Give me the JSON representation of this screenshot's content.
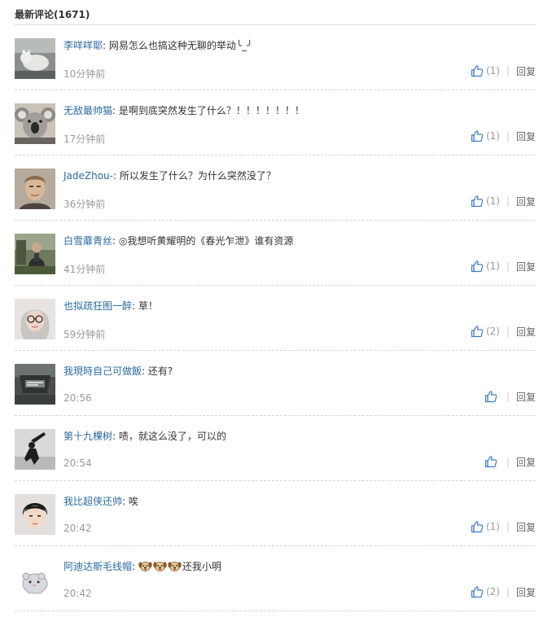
{
  "header": {
    "title": "最新评论(1671)"
  },
  "comments": [
    {
      "username": "李咩咩耶",
      "colon": ":",
      "text": "网易怎么也搞这种无聊的举动╰_╯",
      "time": "10分钟前",
      "likes": "(1)",
      "reply_label": "回复",
      "avatar_icon": "cat-photo-avatar"
    },
    {
      "username": "无敌最帅猫",
      "colon": ":",
      "text": "是啊到底突然发生了什么？！！！！！！！",
      "time": "17分钟前",
      "likes": "(1)",
      "reply_label": "回复",
      "avatar_icon": "koala-photo-avatar"
    },
    {
      "username": "JadeZhou-",
      "colon": ":",
      "text": "所以发生了什么？为什么突然没了？",
      "time": "36分钟前",
      "likes": "(1)",
      "reply_label": "回复",
      "avatar_icon": "portrait-photo-avatar"
    },
    {
      "username": "白雪蘼青丝",
      "colon": ":",
      "text": "◎我想听黄耀明的《春光乍泄》谁有资源",
      "time": "41分钟前",
      "likes": "(1)",
      "reply_label": "回复",
      "avatar_icon": "outdoor-photo-avatar"
    },
    {
      "username": "也拟疏狂图一醉",
      "colon": ":",
      "text": "草！",
      "time": "59分钟前",
      "likes": "(2)",
      "reply_label": "回复",
      "avatar_icon": "glasses-portrait-avatar"
    },
    {
      "username": "我現時自己可做飯",
      "colon": ":",
      "text": "还有?",
      "time": "20:56",
      "likes": "",
      "reply_label": "回复",
      "avatar_icon": "billboard-photo-avatar"
    },
    {
      "username": "第十九棵树",
      "colon": ":",
      "text": "啧，就这么没了，可以的",
      "time": "20:54",
      "likes": "",
      "reply_label": "回复",
      "avatar_icon": "silhouette-photo-avatar"
    },
    {
      "username": "我比超侠还帅",
      "colon": ":",
      "text": "唉",
      "time": "20:42",
      "likes": "(1)",
      "reply_label": "回复",
      "avatar_icon": "short-hair-portrait-avatar"
    },
    {
      "username": "阿迪达斯毛线帽",
      "colon": ":",
      "text": "还我小明",
      "time": "20:42",
      "likes": "(2)",
      "reply_label": "回复",
      "avatar_icon": "hamster-avatar",
      "emoji_count": 3
    }
  ],
  "colors": {
    "username": "#2a6aa0",
    "like_icon": "#3d7cc9",
    "time": "#999999",
    "divider": "#d3d3d3"
  }
}
